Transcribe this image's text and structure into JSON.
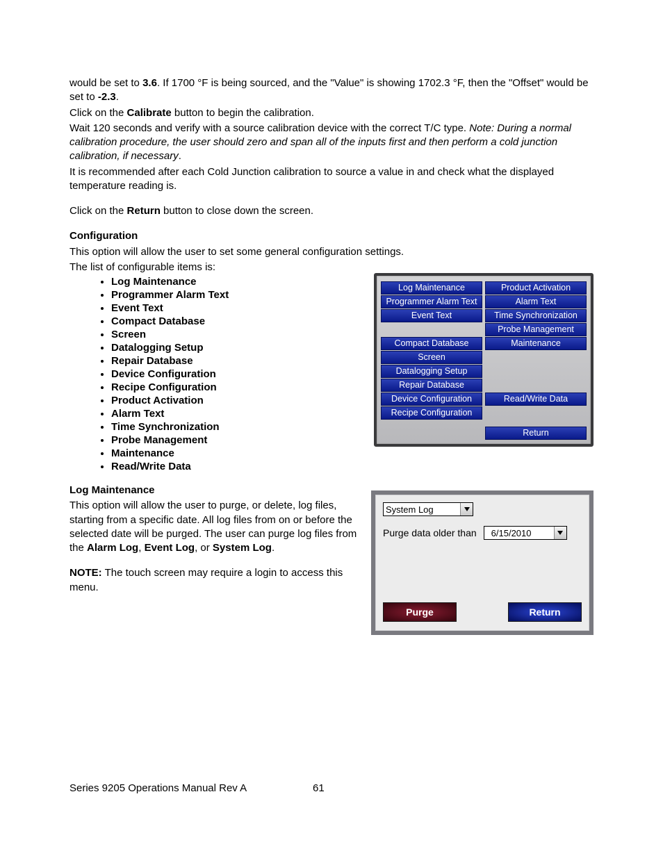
{
  "body": {
    "p1_a": "would be set to ",
    "p1_b": "3.6",
    "p1_c": ".  If 1700 °F is being sourced, and the \"Value\" is showing 1702.3 °F, then the \"Offset\" would be set to ",
    "p1_d": "-2.3",
    "p1_e": ".",
    "p2_a": "Click on the ",
    "p2_b": "Calibrate",
    "p2_c": " button to begin the calibration.",
    "p3_a": "Wait 120 seconds and verify with a source calibration device with the correct T/C type.    ",
    "p3_b": "Note: During a normal calibration procedure, the user should zero and span all of the inputs first and then perform a cold junction calibration, if necessary",
    "p3_c": ".",
    "p4": "It is recommended after each Cold Junction calibration to source a value in and check what the displayed temperature reading is.",
    "p5_a": "Click on the ",
    "p5_b": "Return",
    "p5_c": " button to close down the screen.",
    "h_config": "Configuration",
    "p6": "This option will allow the user to set some general configuration settings.",
    "p7": "The list of configurable items is:",
    "bullets": [
      "Log Maintenance",
      "Programmer Alarm Text",
      "Event Text",
      "Compact Database",
      "Screen",
      "Datalogging Setup",
      "Repair Database",
      "Device Configuration",
      "Recipe Configuration",
      "Product Activation",
      "Alarm Text",
      "Time Synchronization",
      "Probe Management",
      "Maintenance",
      "Read/Write Data"
    ],
    "h_log": "Log Maintenance",
    "p8_a": "This option will allow the user to purge, or delete, log files, starting from a specific date.  All log files from on or before the selected date will be purged.  The user can purge log files from the ",
    "p8_b": "Alarm Log",
    "p8_c": ", ",
    "p8_d": "Event Log",
    "p8_e": ", or ",
    "p8_f": "System Log",
    "p8_g": ".",
    "p9_a": "NOTE:",
    "p9_b": " The touch screen may require a login to access this menu."
  },
  "configPanel": {
    "left": [
      "Log Maintenance",
      "Programmer Alarm Text",
      "Event Text",
      "",
      "Compact Database",
      "Screen",
      "Datalogging Setup",
      "Repair Database",
      "Device Configuration",
      "Recipe Configuration"
    ],
    "right": [
      "Product Activation",
      "Alarm Text",
      "Time Synchronization",
      "Probe Management",
      "Maintenance",
      "",
      "",
      "",
      "Read/Write Data",
      ""
    ],
    "return": "Return"
  },
  "logPanel": {
    "dropdown": "System Log",
    "label": "Purge data older than",
    "date": "6/15/2010",
    "purge": "Purge",
    "return": "Return"
  },
  "footer": {
    "title": "Series 9205 Operations Manual Rev A",
    "page": "61"
  }
}
